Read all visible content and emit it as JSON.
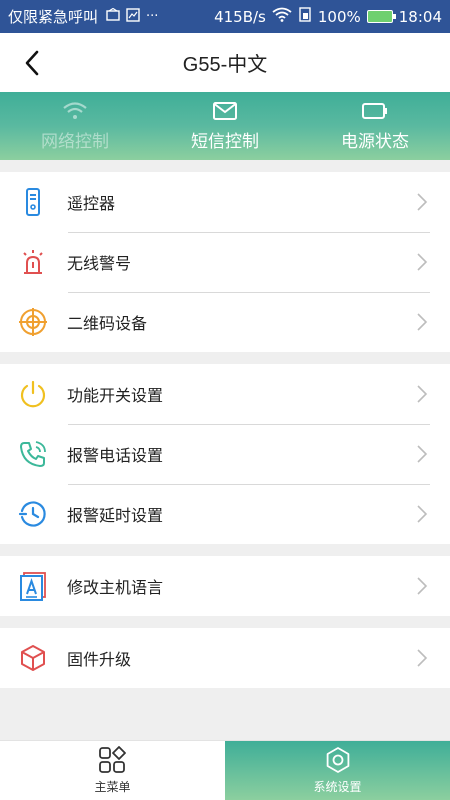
{
  "status_bar": {
    "carrier": "仅限紧急呼叫",
    "extra": "···",
    "speed": "415B/s",
    "battery": "100%",
    "time": "18:04"
  },
  "header": {
    "title": "G55-中文"
  },
  "tabs": [
    {
      "label": "网络控制",
      "icon": "wifi-icon",
      "enabled": false
    },
    {
      "label": "短信控制",
      "icon": "mail-icon",
      "enabled": true
    },
    {
      "label": "电源状态",
      "icon": "battery-icon",
      "enabled": true
    }
  ],
  "menu": {
    "group1": [
      {
        "label": "遥控器",
        "icon": "remote-control-icon"
      },
      {
        "label": "无线警号",
        "icon": "siren-icon"
      },
      {
        "label": "二维码设备",
        "icon": "crosshair-icon"
      }
    ],
    "group2": [
      {
        "label": "功能开关设置",
        "icon": "power-icon"
      },
      {
        "label": "报警电话设置",
        "icon": "phone-icon"
      },
      {
        "label": "报警延时设置",
        "icon": "clock-icon"
      }
    ],
    "group3": [
      {
        "label": "修改主机语言",
        "icon": "language-icon"
      }
    ],
    "group4": [
      {
        "label": "固件升级",
        "icon": "box-icon"
      }
    ]
  },
  "bottom_nav": [
    {
      "label": "主菜单",
      "icon": "grid-icon",
      "active": false
    },
    {
      "label": "系统设置",
      "icon": "settings-icon",
      "active": true
    }
  ],
  "colors": {
    "status_bar": "#2f5497",
    "accent_teal": "#5ab9a0",
    "icon_blue": "#2a8ae0",
    "icon_red": "#e05050",
    "icon_orange": "#f0a030",
    "icon_yellow": "#f0c020",
    "icon_green": "#3cb89a"
  }
}
